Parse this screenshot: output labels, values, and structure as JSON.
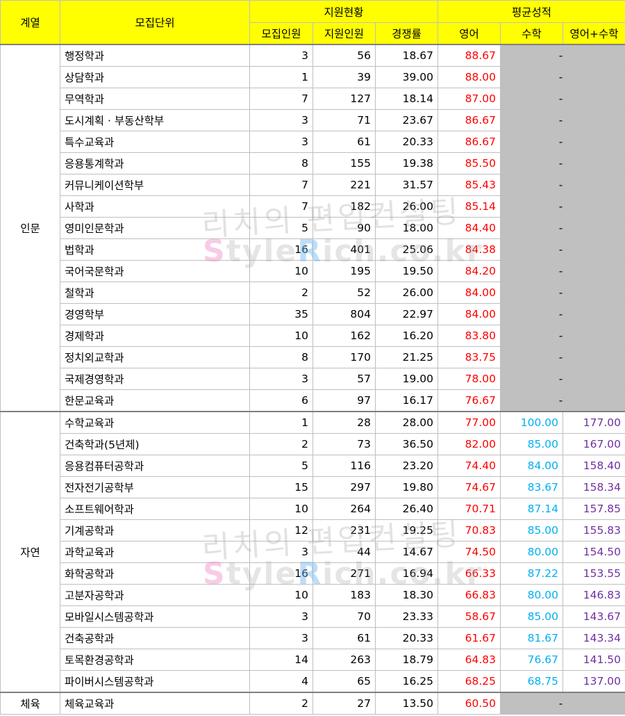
{
  "header": {
    "group": "계열",
    "unit": "모집단위",
    "status": "지원현황",
    "avg": "평균성적",
    "quota": "모집인원",
    "applicants": "지원인원",
    "ratio": "경쟁률",
    "english": "영어",
    "math": "수학",
    "sum": "영어+수학"
  },
  "watermark": {
    "text1": "리치의 편입컨설팅",
    "text2_parts": [
      "S",
      "tyle",
      "R",
      "ich.co.kr"
    ]
  },
  "groups": [
    {
      "label": "인문",
      "rows": [
        {
          "name": "행정학과",
          "quota": "3",
          "applicants": "56",
          "ratio": "18.67",
          "english": "88.67",
          "math": "-"
        },
        {
          "name": "상담학과",
          "quota": "1",
          "applicants": "39",
          "ratio": "39.00",
          "english": "88.00",
          "math": "-"
        },
        {
          "name": "무역학과",
          "quota": "7",
          "applicants": "127",
          "ratio": "18.14",
          "english": "87.00",
          "math": "-"
        },
        {
          "name": "도시계획 · 부동산학부",
          "quota": "3",
          "applicants": "71",
          "ratio": "23.67",
          "english": "86.67",
          "math": "-"
        },
        {
          "name": "특수교육과",
          "quota": "3",
          "applicants": "61",
          "ratio": "20.33",
          "english": "86.67",
          "math": "-"
        },
        {
          "name": "응용통계학과",
          "quota": "8",
          "applicants": "155",
          "ratio": "19.38",
          "english": "85.50",
          "math": "-"
        },
        {
          "name": "커뮤니케이션학부",
          "quota": "7",
          "applicants": "221",
          "ratio": "31.57",
          "english": "85.43",
          "math": "-"
        },
        {
          "name": "사학과",
          "quota": "7",
          "applicants": "182",
          "ratio": "26.00",
          "english": "85.14",
          "math": "-"
        },
        {
          "name": "영미인문학과",
          "quota": "5",
          "applicants": "90",
          "ratio": "18.00",
          "english": "84.40",
          "math": "-"
        },
        {
          "name": "법학과",
          "quota": "16",
          "applicants": "401",
          "ratio": "25.06",
          "english": "84.38",
          "math": "-"
        },
        {
          "name": "국어국문학과",
          "quota": "10",
          "applicants": "195",
          "ratio": "19.50",
          "english": "84.20",
          "math": "-"
        },
        {
          "name": "철학과",
          "quota": "2",
          "applicants": "52",
          "ratio": "26.00",
          "english": "84.00",
          "math": "-"
        },
        {
          "name": "경영학부",
          "quota": "35",
          "applicants": "804",
          "ratio": "22.97",
          "english": "84.00",
          "math": "-"
        },
        {
          "name": "경제학과",
          "quota": "10",
          "applicants": "162",
          "ratio": "16.20",
          "english": "83.80",
          "math": "-"
        },
        {
          "name": "정치외교학과",
          "quota": "8",
          "applicants": "170",
          "ratio": "21.25",
          "english": "83.75",
          "math": "-"
        },
        {
          "name": "국제경영학과",
          "quota": "3",
          "applicants": "57",
          "ratio": "19.00",
          "english": "78.00",
          "math": "-"
        },
        {
          "name": "한문교육과",
          "quota": "6",
          "applicants": "97",
          "ratio": "16.17",
          "english": "76.67",
          "math": "-"
        }
      ]
    },
    {
      "label": "자연",
      "rows": [
        {
          "name": "수학교육과",
          "quota": "1",
          "applicants": "28",
          "ratio": "28.00",
          "english": "77.00",
          "math": "100.00",
          "sum": "177.00"
        },
        {
          "name": "건축학과(5년제)",
          "quota": "2",
          "applicants": "73",
          "ratio": "36.50",
          "english": "82.00",
          "math": "85.00",
          "sum": "167.00"
        },
        {
          "name": "응용컴퓨터공학과",
          "quota": "5",
          "applicants": "116",
          "ratio": "23.20",
          "english": "74.40",
          "math": "84.00",
          "sum": "158.40"
        },
        {
          "name": "전자전기공학부",
          "quota": "15",
          "applicants": "297",
          "ratio": "19.80",
          "english": "74.67",
          "math": "83.67",
          "sum": "158.34"
        },
        {
          "name": "소프트웨어학과",
          "quota": "10",
          "applicants": "264",
          "ratio": "26.40",
          "english": "70.71",
          "math": "87.14",
          "sum": "157.85"
        },
        {
          "name": "기계공학과",
          "quota": "12",
          "applicants": "231",
          "ratio": "19.25",
          "english": "70.83",
          "math": "85.00",
          "sum": "155.83"
        },
        {
          "name": "과학교육과",
          "quota": "3",
          "applicants": "44",
          "ratio": "14.67",
          "english": "74.50",
          "math": "80.00",
          "sum": "154.50"
        },
        {
          "name": "화학공학과",
          "quota": "16",
          "applicants": "271",
          "ratio": "16.94",
          "english": "66.33",
          "math": "87.22",
          "sum": "153.55"
        },
        {
          "name": "고분자공학과",
          "quota": "10",
          "applicants": "183",
          "ratio": "18.30",
          "english": "66.83",
          "math": "80.00",
          "sum": "146.83"
        },
        {
          "name": "모바일시스템공학과",
          "quota": "3",
          "applicants": "70",
          "ratio": "23.33",
          "english": "58.67",
          "math": "85.00",
          "sum": "143.67"
        },
        {
          "name": "건축공학과",
          "quota": "3",
          "applicants": "61",
          "ratio": "20.33",
          "english": "61.67",
          "math": "81.67",
          "sum": "143.34"
        },
        {
          "name": "토목환경공학과",
          "quota": "14",
          "applicants": "263",
          "ratio": "18.79",
          "english": "64.83",
          "math": "76.67",
          "sum": "141.50"
        },
        {
          "name": "파이버시스템공학과",
          "quota": "4",
          "applicants": "65",
          "ratio": "16.25",
          "english": "68.25",
          "math": "68.75",
          "sum": "137.00"
        }
      ]
    },
    {
      "label": "체육",
      "rows": [
        {
          "name": "체육교육과",
          "quota": "2",
          "applicants": "27",
          "ratio": "13.50",
          "english": "60.50",
          "math": "-"
        }
      ]
    }
  ]
}
